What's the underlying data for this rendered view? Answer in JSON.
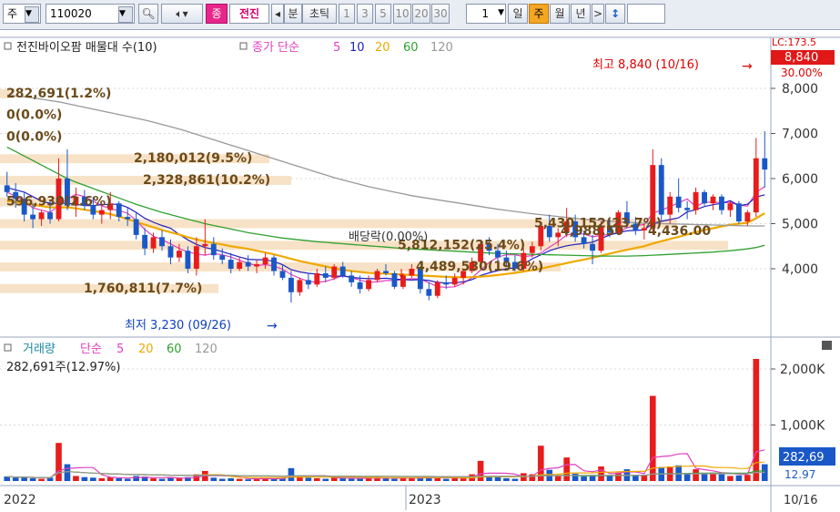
{
  "toolbar": {
    "market": "주",
    "code": "110020",
    "stock_name": "전진",
    "tag": "종",
    "period_left": "◂",
    "unit_min": "분",
    "unit_tick": "초틱",
    "nums": [
      "1",
      "3",
      "5",
      "10",
      "20",
      "30"
    ],
    "count": "1",
    "day": "일",
    "week": "주",
    "month": "월",
    "year": "년",
    "next": ">",
    "updown": "↕"
  },
  "chart_data": [
    {
      "type": "candlestick",
      "panel": "price",
      "title": "전진바이오팜 매물대 수(10)",
      "ma_label": "종가 단순",
      "ma_periods": [
        "5",
        "10",
        "20",
        "60",
        "120"
      ],
      "ma_colors": [
        "#e040c0",
        "#2020c0",
        "#f0a800",
        "#30a030",
        "#999999"
      ],
      "y_ticks": [
        "8,000",
        "7,000",
        "6,000",
        "5,000",
        "4,000"
      ],
      "y_tick_values": [
        8000,
        7000,
        6000,
        5000,
        4000
      ],
      "ylim": [
        3000,
        8400
      ],
      "x_labels": [
        "2022",
        "2023",
        "10/16"
      ],
      "current_price": "8,840",
      "top_right_tags": [
        "LC:173.5",
        "30.00%"
      ],
      "high_label": "최고 8,840 (10/16)",
      "low_label": "최저 3,230 (09/26)",
      "dividend_label": "배당락(0.00%)",
      "volume_profile": [
        {
          "label": "282,691(1.2%)",
          "price": 7880,
          "width": 0.02
        },
        {
          "label": "0(0.0%)",
          "price": 7400,
          "width": 0.0
        },
        {
          "label": "0(0.0%)",
          "price": 6920,
          "width": 0.0
        },
        {
          "label": "2,180,012(9.5%)",
          "price": 6440,
          "width": 0.37
        },
        {
          "label": "2,328,861(10.2%)",
          "price": 5960,
          "width": 0.4
        },
        {
          "label": "596,930(2.6%)",
          "price": 5480,
          "width": 0.1
        },
        {
          "label": "5,430,152(23.7%)",
          "price": 5000,
          "width": 0.93
        },
        {
          "label": "5,812,152(25.4%)",
          "price": 4520,
          "width": 1.0
        },
        {
          "label": "4,489,530(19.6%)",
          "price": 4040,
          "width": 0.77
        },
        {
          "label": "1,760,811(7.7%)",
          "price": 3560,
          "width": 0.3
        }
      ],
      "vp_extra_labels": [
        "4,988.50",
        "4,436.00"
      ],
      "candles": [
        [
          5850,
          6150,
          5600,
          5700
        ],
        [
          5700,
          5900,
          5350,
          5550
        ],
        [
          5550,
          5700,
          5050,
          5200
        ],
        [
          5200,
          5450,
          4900,
          5100
        ],
        [
          5100,
          5300,
          4950,
          5250
        ],
        [
          5250,
          5500,
          5000,
          5100
        ],
        [
          5100,
          6450,
          5050,
          6000
        ],
        [
          6000,
          6650,
          5300,
          5400
        ],
        [
          5400,
          5800,
          5150,
          5600
        ],
        [
          5600,
          5750,
          5300,
          5400
        ],
        [
          5400,
          5600,
          5100,
          5200
        ],
        [
          5200,
          5450,
          5000,
          5300
        ],
        [
          5300,
          5700,
          5100,
          5450
        ],
        [
          5450,
          5500,
          5050,
          5150
        ],
        [
          5150,
          5350,
          4950,
          5100
        ],
        [
          5100,
          5250,
          4650,
          4750
        ],
        [
          4750,
          4900,
          4300,
          4450
        ],
        [
          4450,
          4800,
          4350,
          4700
        ],
        [
          4700,
          4850,
          4400,
          4500
        ],
        [
          4500,
          4650,
          4100,
          4250
        ],
        [
          4250,
          4550,
          4150,
          4400
        ],
        [
          4400,
          4500,
          3900,
          4000
        ],
        [
          4000,
          4700,
          3850,
          4500
        ],
        [
          4500,
          5100,
          4300,
          4550
        ],
        [
          4550,
          4700,
          4200,
          4300
        ],
        [
          4300,
          4450,
          4100,
          4200
        ],
        [
          4200,
          4350,
          3900,
          4000
        ],
        [
          4000,
          4250,
          3950,
          4150
        ],
        [
          4150,
          4300,
          3950,
          4050
        ],
        [
          4050,
          4200,
          3900,
          4100
        ],
        [
          4100,
          4350,
          4000,
          4250
        ],
        [
          4250,
          4300,
          3850,
          3950
        ],
        [
          3950,
          4100,
          3750,
          3800
        ],
        [
          3800,
          3950,
          3250,
          3480
        ],
        [
          3480,
          3800,
          3400,
          3750
        ],
        [
          3750,
          3900,
          3550,
          3650
        ],
        [
          3650,
          4000,
          3600,
          3900
        ],
        [
          3900,
          4050,
          3700,
          3800
        ],
        [
          3800,
          4100,
          3750,
          4050
        ],
        [
          4050,
          4150,
          3800,
          3850
        ],
        [
          3850,
          3950,
          3600,
          3700
        ],
        [
          3700,
          3850,
          3450,
          3550
        ],
        [
          3550,
          3850,
          3500,
          3750
        ],
        [
          3750,
          4000,
          3700,
          3950
        ],
        [
          3950,
          4100,
          3850,
          3900
        ],
        [
          3900,
          3950,
          3550,
          3600
        ],
        [
          3600,
          3900,
          3550,
          3850
        ],
        [
          3850,
          4100,
          3800,
          4000
        ],
        [
          4000,
          4050,
          3450,
          3550
        ],
        [
          3550,
          3700,
          3300,
          3400
        ],
        [
          3400,
          3750,
          3350,
          3700
        ],
        [
          3700,
          3850,
          3550,
          3650
        ],
        [
          3650,
          3900,
          3600,
          3800
        ],
        [
          3800,
          4000,
          3650,
          3950
        ],
        [
          3950,
          4250,
          3900,
          4150
        ],
        [
          4150,
          4650,
          4100,
          4550
        ],
        [
          4550,
          4700,
          4300,
          4400
        ],
        [
          4400,
          4550,
          4100,
          4250
        ],
        [
          4250,
          4400,
          4050,
          4150
        ],
        [
          4150,
          4300,
          3950,
          4000
        ],
        [
          4000,
          4450,
          3950,
          4350
        ],
        [
          4350,
          4600,
          4250,
          4500
        ],
        [
          4500,
          5000,
          4400,
          4950
        ],
        [
          4950,
          5200,
          4600,
          4700
        ],
        [
          4700,
          4900,
          4500,
          4800
        ],
        [
          4800,
          5350,
          4700,
          5050
        ],
        [
          5050,
          5200,
          4600,
          4700
        ],
        [
          4700,
          4850,
          4450,
          4550
        ],
        [
          4550,
          4750,
          4100,
          4400
        ],
        [
          4400,
          5050,
          4350,
          4950
        ],
        [
          4950,
          5100,
          4700,
          4800
        ],
        [
          4800,
          5300,
          4750,
          5250
        ],
        [
          5250,
          5500,
          4900,
          5000
        ],
        [
          5000,
          5150,
          4750,
          4850
        ],
        [
          4850,
          5000,
          4650,
          4900
        ],
        [
          4900,
          6650,
          4800,
          6300
        ],
        [
          6300,
          6450,
          5050,
          5200
        ],
        [
          5200,
          5700,
          5000,
          5600
        ],
        [
          5600,
          6000,
          5250,
          5350
        ],
        [
          5350,
          5500,
          5100,
          5300
        ],
        [
          5300,
          5800,
          5200,
          5700
        ],
        [
          5700,
          5750,
          5400,
          5450
        ],
        [
          5450,
          5650,
          5300,
          5600
        ],
        [
          5600,
          5650,
          5200,
          5300
        ],
        [
          5300,
          5500,
          5150,
          5450
        ],
        [
          5450,
          5500,
          5000,
          5050
        ],
        [
          5050,
          5300,
          4950,
          5250
        ],
        [
          5250,
          6900,
          5150,
          6450
        ],
        [
          6450,
          7050,
          5800,
          6200
        ]
      ],
      "ma_series": {
        "5": [
          5700,
          5600,
          5500,
          5350,
          5300,
          5250,
          5400,
          5550,
          5650,
          5600,
          5500,
          5400,
          5330,
          5290,
          5230,
          5070,
          4870,
          4720,
          4650,
          4550,
          4450,
          4370,
          4330,
          4300,
          4340,
          4310,
          4260,
          4190,
          4120,
          4070,
          4090,
          4060,
          3990,
          3870,
          3790,
          3720,
          3700,
          3720,
          3780,
          3850,
          3800,
          3750,
          3700,
          3710,
          3740,
          3740,
          3760,
          3780,
          3770,
          3690,
          3600,
          3590,
          3600,
          3680,
          3800,
          3970,
          4140,
          4260,
          4310,
          4310,
          4270,
          4290,
          4350,
          4480,
          4600,
          4750,
          4780,
          4770,
          4710,
          4740,
          4760,
          4810,
          4910,
          4960,
          4980,
          5230,
          5300,
          5380,
          5460,
          5550,
          5380,
          5470,
          5480,
          5460,
          5470,
          5410,
          5390,
          5690,
          5820
        ],
        "10": [
          5800,
          5750,
          5700,
          5600,
          5500,
          5450,
          5450,
          5450,
          5430,
          5400,
          5400,
          5420,
          5430,
          5430,
          5360,
          5250,
          5120,
          5030,
          4960,
          4900,
          4760,
          4640,
          4540,
          4470,
          4430,
          4380,
          4320,
          4260,
          4210,
          4200,
          4200,
          4160,
          4090,
          3980,
          3930,
          3900,
          3880,
          3850,
          3830,
          3840,
          3810,
          3790,
          3780,
          3780,
          3790,
          3770,
          3760,
          3750,
          3760,
          3740,
          3700,
          3680,
          3690,
          3710,
          3760,
          3850,
          3910,
          3960,
          4000,
          4020,
          4110,
          4220,
          4310,
          4400,
          4460,
          4510,
          4540,
          4560,
          4590,
          4670,
          4750,
          4800,
          4840,
          4850,
          4860,
          5010,
          5050,
          5090,
          5130,
          5260,
          5310,
          5380,
          5420,
          5450,
          5510,
          5400,
          5430,
          5590,
          5640
        ],
        "20": [
          5500,
          5480,
          5460,
          5420,
          5390,
          5360,
          5360,
          5360,
          5340,
          5310,
          5280,
          5250,
          5210,
          5160,
          5100,
          5040,
          4980,
          4920,
          4860,
          4810,
          4760,
          4700,
          4650,
          4610,
          4570,
          4540,
          4500,
          4470,
          4440,
          4400,
          4360,
          4320,
          4270,
          4220,
          4170,
          4130,
          4090,
          4050,
          4010,
          3980,
          3950,
          3930,
          3910,
          3900,
          3890,
          3880,
          3870,
          3860,
          3850,
          3840,
          3830,
          3820,
          3815,
          3810,
          3815,
          3825,
          3840,
          3860,
          3885,
          3910,
          3940,
          3970,
          4005,
          4045,
          4085,
          4125,
          4165,
          4205,
          4245,
          4290,
          4335,
          4380,
          4420,
          4460,
          4500,
          4560,
          4610,
          4660,
          4710,
          4760,
          4810,
          4860,
          4900,
          4940,
          4975,
          5000,
          5020,
          5120,
          5230
        ],
        "60": [
          6700,
          6600,
          6500,
          6400,
          6300,
          6200,
          6100,
          6000,
          5920,
          5850,
          5780,
          5710,
          5640,
          5570,
          5500,
          5430,
          5370,
          5310,
          5250,
          5200,
          5150,
          5100,
          5050,
          5000,
          4960,
          4920,
          4880,
          4840,
          4800,
          4770,
          4740,
          4710,
          4680,
          4660,
          4640,
          4620,
          4600,
          4585,
          4570,
          4555,
          4540,
          4525,
          4510,
          4495,
          4480,
          4465,
          4450,
          4440,
          4430,
          4420,
          4410,
          4400,
          4390,
          4380,
          4370,
          4360,
          4350,
          4340,
          4335,
          4330,
          4325,
          4320,
          4315,
          4310,
          4305,
          4300,
          4295,
          4290,
          4285,
          4280,
          4280,
          4280,
          4280,
          4285,
          4290,
          4300,
          4310,
          4320,
          4330,
          4340,
          4350,
          4360,
          4370,
          4385,
          4400,
          4420,
          4440,
          4470,
          4520
        ],
        "120": [
          7850,
          7830,
          7810,
          7790,
          7760,
          7730,
          7700,
          7660,
          7620,
          7580,
          7540,
          7500,
          7460,
          7420,
          7380,
          7340,
          7300,
          7250,
          7200,
          7150,
          7100,
          7040,
          6980,
          6920,
          6860,
          6800,
          6740,
          6680,
          6620,
          6560,
          6500,
          6440,
          6380,
          6320,
          6260,
          6200,
          6140,
          6080,
          6020,
          5970,
          5920,
          5870,
          5820,
          5780,
          5740,
          5700,
          5660,
          5620,
          5590,
          5560,
          5530,
          5500,
          5470,
          5440,
          5410,
          5380,
          5350,
          5320,
          5295,
          5270,
          5245,
          5220,
          5200,
          5180,
          5160,
          5140,
          5120,
          5100,
          5085,
          5070,
          5055,
          5040,
          5030,
          5020,
          5010,
          5005,
          5000,
          4995,
          4990,
          4985,
          4980,
          4975,
          4970,
          4965,
          4960,
          4955,
          4950,
          4950,
          4950
        ]
      }
    },
    {
      "type": "bar",
      "panel": "volume",
      "title": "거래량",
      "ma_label": "단순",
      "ma_periods": [
        "5",
        "20",
        "60",
        "120"
      ],
      "ma_colors": [
        "#e040c0",
        "#f0a800",
        "#30a030",
        "#999999"
      ],
      "info": "282,691주(12.97%)",
      "y_ticks": [
        "2,000K",
        "1,000K"
      ],
      "y_tick_values": [
        2000,
        1000
      ],
      "ylim": [
        0,
        2500
      ],
      "current_value": "282,69",
      "current_pct": "12.97",
      "values": [
        80,
        60,
        70,
        50,
        40,
        60,
        680,
        300,
        90,
        70,
        60,
        50,
        70,
        50,
        40,
        90,
        80,
        50,
        40,
        60,
        50,
        70,
        120,
        180,
        60,
        40,
        50,
        40,
        30,
        40,
        50,
        40,
        50,
        230,
        90,
        60,
        50,
        40,
        70,
        50,
        40,
        40,
        60,
        70,
        50,
        40,
        50,
        60,
        80,
        60,
        50,
        40,
        60,
        70,
        120,
        360,
        90,
        70,
        50,
        40,
        140,
        120,
        630,
        200,
        90,
        420,
        130,
        80,
        110,
        260,
        90,
        150,
        210,
        100,
        110,
        1520,
        250,
        260,
        280,
        140,
        210,
        130,
        150,
        120,
        90,
        100,
        110,
        2180,
        300
      ]
    }
  ]
}
